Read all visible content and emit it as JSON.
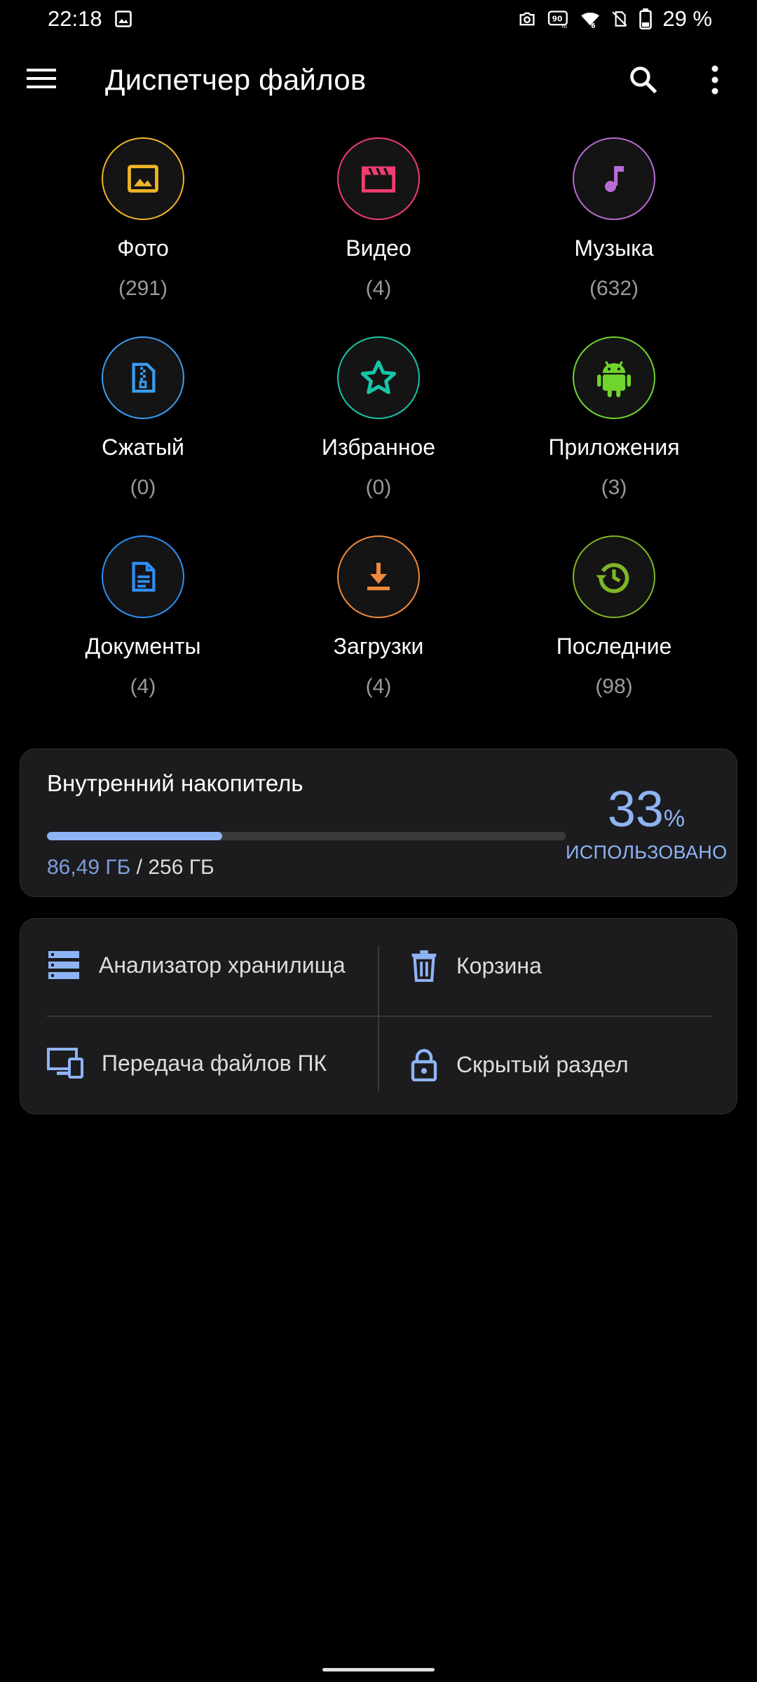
{
  "status_bar": {
    "time": "22:18",
    "battery": "29 %",
    "icons": [
      "image-icon",
      "camera-icon",
      "hz-icon",
      "wifi-icon",
      "no-sim-icon",
      "battery-icon"
    ]
  },
  "app_bar": {
    "title": "Диспетчер файлов",
    "icons": [
      "menu-icon",
      "search-icon",
      "more-vert-icon"
    ]
  },
  "categories": [
    {
      "name": "Фото",
      "count": "(291)",
      "icon": "photo-icon",
      "color": "#f0b429"
    },
    {
      "name": "Видео",
      "count": "(4)",
      "icon": "video-clapper-icon",
      "color": "#ef3d6f"
    },
    {
      "name": "Музыка",
      "count": "(632)",
      "icon": "music-note-icon",
      "color": "#b96bd3"
    },
    {
      "name": "Сжатый",
      "count": "(0)",
      "icon": "zip-file-icon",
      "color": "#3b9df0"
    },
    {
      "name": "Избранное",
      "count": "(0)",
      "icon": "star-icon",
      "color": "#17c4a8"
    },
    {
      "name": "Приложения",
      "count": "(3)",
      "icon": "android-icon",
      "color": "#6fd42c"
    },
    {
      "name": "Документы",
      "count": "(4)",
      "icon": "document-icon",
      "color": "#2f8ef4"
    },
    {
      "name": "Загрузки",
      "count": "(4)",
      "icon": "download-icon",
      "color": "#f08a3c"
    },
    {
      "name": "Последние",
      "count": "(98)",
      "icon": "history-icon",
      "color": "#7fb526"
    }
  ],
  "storage": {
    "title": "Внутренний накопитель",
    "used": "86,49 ГБ",
    "separator": " / ",
    "total": "256 ГБ",
    "percent": "33",
    "percent_sign": "%",
    "percent_label": "ИСПОЛЬЗОВАНО",
    "used_fraction": 0.338,
    "accent": "#8fb4f5"
  },
  "tools": [
    {
      "label": "Анализатор хранилища",
      "icon": "storage-analyzer-icon"
    },
    {
      "label": "Корзина",
      "icon": "trash-icon"
    },
    {
      "label": "Передача файлов ПК",
      "icon": "pc-transfer-icon"
    },
    {
      "label": "Скрытый раздел",
      "icon": "lock-icon"
    }
  ]
}
